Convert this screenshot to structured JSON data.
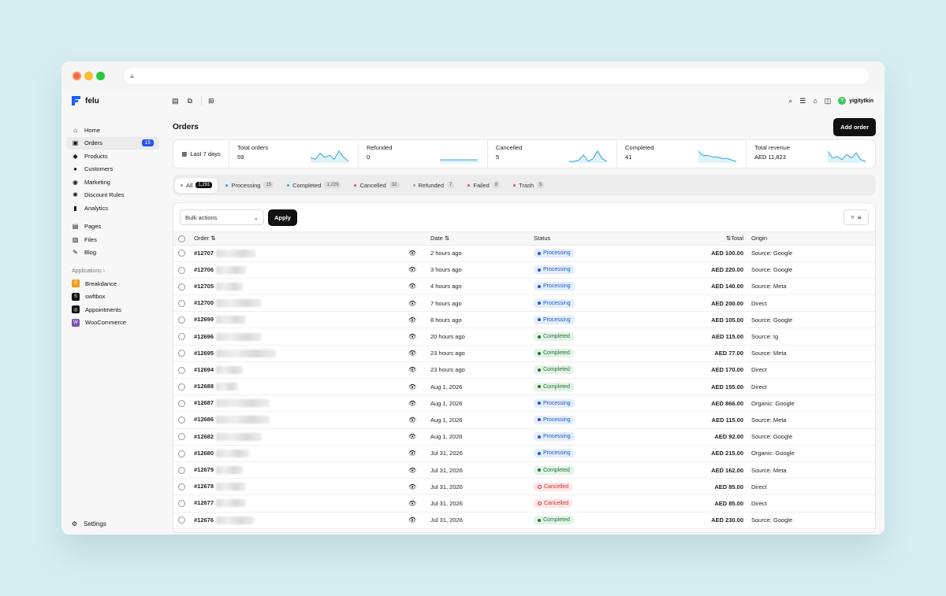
{
  "brand": {
    "name": "felu"
  },
  "sidebar": {
    "items": [
      {
        "label": "Home",
        "icon": "home-icon",
        "glyph": "⌂"
      },
      {
        "label": "Orders",
        "icon": "inbox-icon",
        "glyph": "▣",
        "badge": "15",
        "active": true
      },
      {
        "label": "Products",
        "icon": "tag-icon",
        "glyph": "◆"
      },
      {
        "label": "Customers",
        "icon": "users-icon",
        "glyph": "●"
      },
      {
        "label": "Marketing",
        "icon": "compass-icon",
        "glyph": "◉"
      },
      {
        "label": "Discount Rules",
        "icon": "percent-icon",
        "glyph": "✺"
      },
      {
        "label": "Analytics",
        "icon": "bar-chart-icon",
        "glyph": "▮"
      }
    ],
    "content_items": [
      {
        "label": "Pages",
        "icon": "page-icon",
        "glyph": "▤"
      },
      {
        "label": "Files",
        "icon": "image-icon",
        "glyph": "▨"
      },
      {
        "label": "Blog",
        "icon": "pen-icon",
        "glyph": "✎"
      }
    ],
    "applications_label": "Applications ›",
    "apps": [
      {
        "label": "Breakdance",
        "icon": "breakdance-icon",
        "color": "#f39a1e",
        "glyph": "B"
      },
      {
        "label": "swftbox",
        "icon": "swftbox-icon",
        "color": "#111111",
        "glyph": "S"
      },
      {
        "label": "Appointments",
        "icon": "appointments-icon",
        "color": "#111111",
        "glyph": "◎"
      },
      {
        "label": "WooCommerce",
        "icon": "woocommerce-icon",
        "color": "#7f54b3",
        "glyph": "W"
      }
    ],
    "settings_label": "Settings"
  },
  "topbar": {
    "user": "yigitytkin",
    "avatar_letter": "Y"
  },
  "page": {
    "title": "Orders",
    "add_button": "Add order"
  },
  "stats": {
    "range": "Last 7 days",
    "cards": [
      {
        "label": "Total orders",
        "value": "59",
        "trend": [
          6,
          5,
          8,
          6,
          7,
          5,
          9,
          6,
          4
        ],
        "color": "#2ba6e0"
      },
      {
        "label": "Refunded",
        "value": "0",
        "trend": [
          2,
          2,
          2,
          2,
          2,
          2,
          2,
          2,
          2
        ],
        "color": "#2ba6e0"
      },
      {
        "label": "Cancelled",
        "value": "5",
        "trend": [
          1,
          1,
          2,
          6,
          1,
          3,
          9,
          3,
          1
        ],
        "color": "#2ba6e0"
      },
      {
        "label": "Completed",
        "value": "41",
        "trend": [
          9,
          6,
          6,
          5,
          5,
          4,
          4,
          3,
          2
        ],
        "color": "#2ba6e0"
      },
      {
        "label": "Total revenue",
        "value": "AED 11,823",
        "trend": [
          9,
          5,
          6,
          4,
          7,
          5,
          8,
          4,
          3
        ],
        "color": "#2ba6e0"
      }
    ]
  },
  "tabs": [
    {
      "label": "All",
      "count": "1,291",
      "dot": "#999999",
      "active": true
    },
    {
      "label": "Processing",
      "count": "15",
      "dot": "#2ba6e0"
    },
    {
      "label": "Completed",
      "count": "1,229",
      "dot": "#2ba6e0"
    },
    {
      "label": "Cancelled",
      "count": "32",
      "dot": "#e05252"
    },
    {
      "label": "Refunded",
      "count": "7",
      "dot": "#999999"
    },
    {
      "label": "Failed",
      "count": "8",
      "dot": "#e05252"
    },
    {
      "label": "Trash",
      "count": "5",
      "dot": "#e05252"
    }
  ],
  "table": {
    "bulk_placeholder": "Bulk actions",
    "apply_label": "Apply",
    "headers": {
      "order": "Order ⇅",
      "date": "Date ⇅",
      "status": "Status",
      "total": "⇅Total",
      "origin": "Origin"
    },
    "rows": [
      {
        "order": "#12707",
        "date": "2 hours ago",
        "status": "Processing",
        "total": "AED 100.00",
        "origin": "Source: Google"
      },
      {
        "order": "#12706",
        "date": "3 hours ago",
        "status": "Processing",
        "total": "AED 220.00",
        "origin": "Source: Google"
      },
      {
        "order": "#12705",
        "date": "4 hours ago",
        "status": "Processing",
        "total": "AED 140.00",
        "origin": "Source: Meta"
      },
      {
        "order": "#12700",
        "date": "7 hours ago",
        "status": "Processing",
        "total": "AED 200.00",
        "origin": "Direct"
      },
      {
        "order": "#12699",
        "date": "8 hours ago",
        "status": "Processing",
        "total": "AED 105.00",
        "origin": "Source: Google"
      },
      {
        "order": "#12696",
        "date": "20 hours ago",
        "status": "Completed",
        "total": "AED 115.00",
        "origin": "Source: Ig"
      },
      {
        "order": "#12695",
        "date": "23 hours ago",
        "status": "Completed",
        "total": "AED 77.00",
        "origin": "Source: Meta"
      },
      {
        "order": "#12694",
        "date": "23 hours ago",
        "status": "Completed",
        "total": "AED 170.00",
        "origin": "Direct"
      },
      {
        "order": "#12688",
        "date": "Aug 1, 2026",
        "status": "Completed",
        "total": "AED 155.00",
        "origin": "Direct"
      },
      {
        "order": "#12687",
        "date": "Aug 1, 2026",
        "status": "Processing",
        "total": "AED 866.00",
        "origin": "Organic: Google"
      },
      {
        "order": "#12686",
        "date": "Aug 1, 2026",
        "status": "Processing",
        "total": "AED 115.00",
        "origin": "Source: Meta"
      },
      {
        "order": "#12682",
        "date": "Aug 1, 2026",
        "status": "Processing",
        "total": "AED 92.00",
        "origin": "Source: Google"
      },
      {
        "order": "#12680",
        "date": "Jul 31, 2026",
        "status": "Processing",
        "total": "AED 215.00",
        "origin": "Organic: Google"
      },
      {
        "order": "#12679",
        "date": "Jul 31, 2026",
        "status": "Completed",
        "total": "AED 162.00",
        "origin": "Source: Meta"
      },
      {
        "order": "#12678",
        "date": "Jul 31, 2026",
        "status": "Cancelled",
        "total": "AED 85.00",
        "origin": "Direct"
      },
      {
        "order": "#12677",
        "date": "Jul 31, 2026",
        "status": "Cancelled",
        "total": "AED 85.00",
        "origin": "Direct"
      },
      {
        "order": "#12676",
        "date": "Jul 31, 2026",
        "status": "Completed",
        "total": "AED 230.00",
        "origin": "Source: Google"
      }
    ]
  }
}
